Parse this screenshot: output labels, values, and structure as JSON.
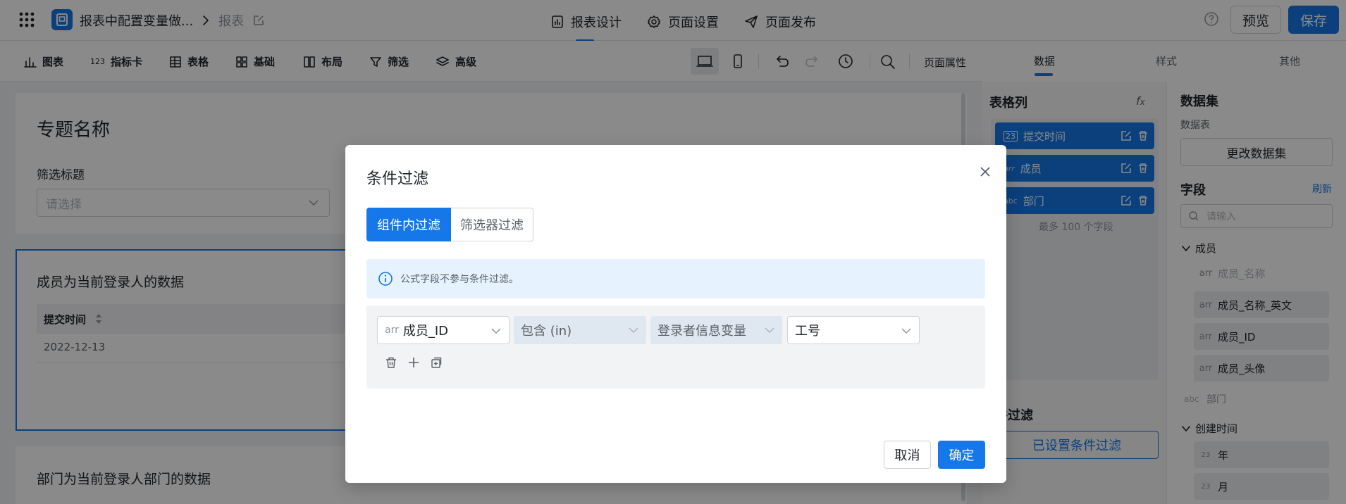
{
  "header": {
    "breadcrumb_title": "报表中配置变量做...",
    "breadcrumb_section": "报表",
    "tabs": [
      {
        "label": "报表设计",
        "icon": "report-design-icon"
      },
      {
        "label": "页面设置",
        "icon": "gear-icon"
      },
      {
        "label": "页面发布",
        "icon": "send-icon"
      }
    ],
    "preview_label": "预览",
    "save_label": "保存",
    "accent_color": "#1677e8"
  },
  "toolbar": {
    "items": [
      {
        "label": "图表",
        "icon": "bar-chart-icon"
      },
      {
        "label": "指标卡",
        "icon": "metric-icon"
      },
      {
        "label": "表格",
        "icon": "table-icon"
      },
      {
        "label": "基础",
        "icon": "grid-icon"
      },
      {
        "label": "布局",
        "icon": "layout-icon"
      },
      {
        "label": "筛选",
        "icon": "filter-icon"
      },
      {
        "label": "高级",
        "icon": "layers-icon"
      }
    ],
    "page_props_label": "页面属性"
  },
  "right_panel": {
    "tabs": [
      "数据",
      "样式",
      "其他"
    ],
    "columns_title": "表格列",
    "columns": [
      {
        "type": "23",
        "name": "提交时间"
      },
      {
        "type": "arr",
        "name": "成员"
      },
      {
        "type": "abc",
        "name": "部门"
      }
    ],
    "columns_limit": "最多 100 个字段",
    "filter_title": "件过滤",
    "filter_status": "已设置条件过滤",
    "dataset_title": "数据集",
    "dataset_table_label": "数据表",
    "change_dataset_label": "更改数据集",
    "fields_title": "字段",
    "refresh_label": "刷新",
    "fields_search_placeholder": "请输入",
    "field_groups": [
      {
        "group": "成员",
        "items": [
          {
            "type": "arr",
            "name": "成员_名称",
            "disabled": true
          },
          {
            "type": "arr",
            "name": "成员_名称_英文"
          },
          {
            "type": "arr",
            "name": "成员_ID"
          },
          {
            "type": "arr",
            "name": "成员_头像"
          }
        ]
      },
      {
        "plain": {
          "type": "abc",
          "name": "部门"
        }
      },
      {
        "group": "创建时间",
        "items": [
          {
            "type": "23",
            "name": "年"
          },
          {
            "type": "23",
            "name": "月"
          }
        ]
      }
    ]
  },
  "canvas": {
    "topic_title": "专题名称",
    "filter_label": "筛选标题",
    "filter_placeholder": "请选择",
    "card2_title": "成员为当前登录人的数据",
    "table_header": "提交时间",
    "table_first_cell": "2022-12-13",
    "card3_title": "部门为当前登录人部门的数据"
  },
  "modal": {
    "title": "条件过滤",
    "tabs": [
      {
        "label": "组件内过滤",
        "active": true
      },
      {
        "label": "筛选器过滤",
        "active": false
      }
    ],
    "info_text": "公式字段不参与条件过滤。",
    "condition": {
      "field_type": "arr",
      "field": "成员_ID",
      "operator": "包含 (in)",
      "value_source": "登录者信息变量",
      "value": "工号"
    },
    "cancel_label": "取消",
    "confirm_label": "确定"
  }
}
